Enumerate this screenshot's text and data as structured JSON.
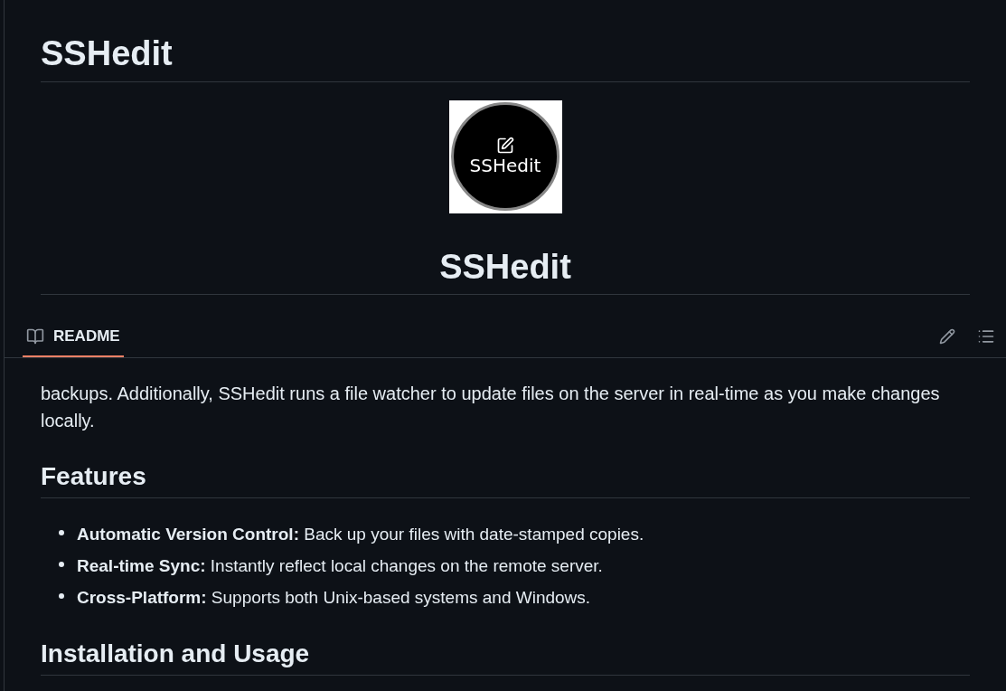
{
  "title": "SSHedit",
  "logo": {
    "text": "SSHedit"
  },
  "centered_title": "SSHedit",
  "readme_bar": {
    "label": "README",
    "selected": true
  },
  "intro": "backups. Additionally, SSHedit runs a file watcher to update files on the server in real-time as you make changes locally.",
  "features": {
    "heading": "Features",
    "items": [
      {
        "name": "Automatic Version Control:",
        "text": "Back up your files with date-stamped copies."
      },
      {
        "name": "Real-time Sync:",
        "text": "Instantly reflect local changes on the remote server."
      },
      {
        "name": "Cross-Platform:",
        "text": "Supports both Unix-based systems and Windows."
      }
    ]
  },
  "next_heading": "Installation and Usage"
}
